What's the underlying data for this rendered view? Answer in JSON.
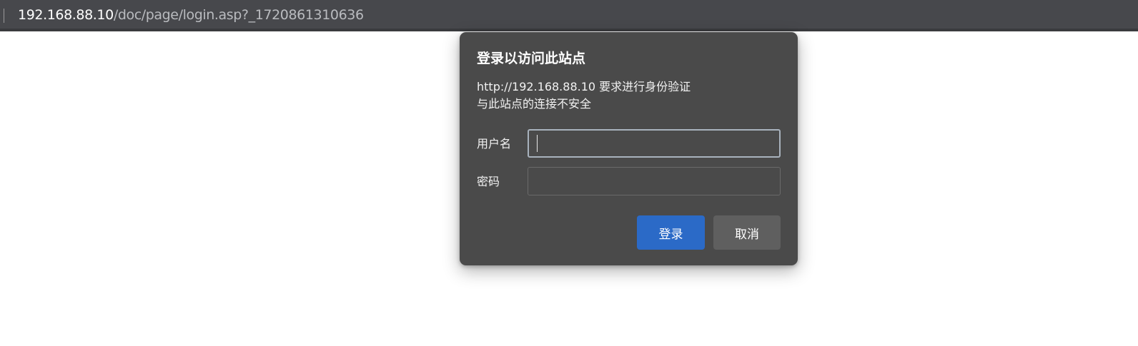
{
  "address_bar": {
    "host": "192.168.88.10",
    "path": "/doc/page/login.asp?_1720861310636"
  },
  "auth_dialog": {
    "title": "登录以访问此站点",
    "message_line1": "http://192.168.88.10 要求进行身份验证",
    "message_line2": "与此站点的连接不安全",
    "username_label": "用户名",
    "username_value": "",
    "password_label": "密码",
    "password_value": "",
    "login_label": "登录",
    "cancel_label": "取消"
  },
  "colors": {
    "dialog_bg": "#4a4a4a",
    "primary_button": "#2b6ac7",
    "secondary_button": "#5f5f5f",
    "addressbar_bg": "#47484c"
  }
}
